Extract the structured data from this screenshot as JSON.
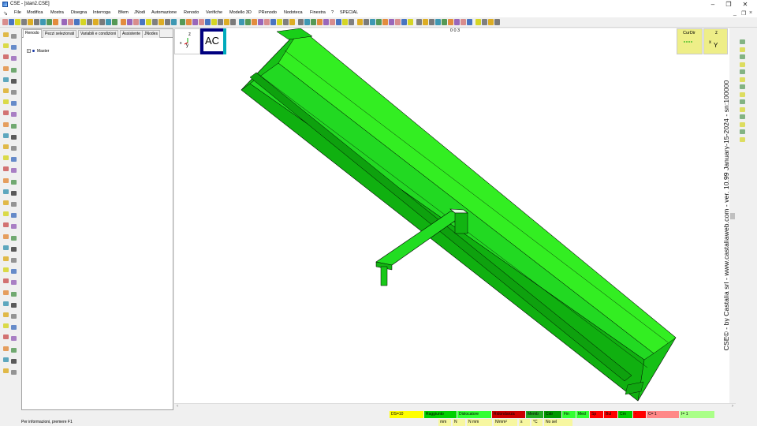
{
  "window": {
    "title": "CSE - [stan2.CSE]",
    "controls": {
      "minimize": "–",
      "restore": "❐",
      "close": "✕"
    },
    "mdi_controls": {
      "minimize": "_",
      "restore": "❐",
      "close": "×"
    }
  },
  "menu": {
    "items": [
      "File",
      "Modifica",
      "Mostra",
      "Disegna",
      "Interroga",
      "Bfem",
      "JNodi",
      "Automazione",
      "Renodo",
      "Verifiche",
      "Modello 3D",
      "PRenodo",
      "Nodoteca",
      "Finestra",
      "?",
      "SPECIAL"
    ]
  },
  "panel": {
    "tabs": [
      "Renodo",
      "Pezzi selezionati",
      "Variabili e condizioni",
      "Assistente",
      "JNodes"
    ],
    "active_tab": "Renodo",
    "tree": {
      "expander": "+",
      "root_label": "Master"
    }
  },
  "viewport": {
    "view_label": "0 0 3",
    "axis_indicator_left": {
      "z": "z",
      "x": "x",
      "y": "y"
    },
    "ac_badge": "AC",
    "curdir": {
      "label": "CurDir"
    },
    "axis_indicator_right": {
      "z": "z",
      "x": "x",
      "y": "Y"
    },
    "model_color": "#22d922",
    "version_text": "CSE© - by Castalia srl - www.castaliaweb.com - ver. 10.99 January-15-2024 - sn:100000"
  },
  "status": {
    "info_text": "Per informazioni, premere F1",
    "legend": [
      {
        "label": "DS=10",
        "color": "#ffff00"
      },
      {
        "label": "Raggiunto",
        "color": "#00d000"
      },
      {
        "label": "Dislocatore",
        "color": "#33ff33"
      },
      {
        "label": "Ridondanza",
        "color": "#cc0000"
      },
      {
        "label": "Memb",
        "color": "#22aa22"
      },
      {
        "label": "Cxtr",
        "color": "#009900"
      },
      {
        "label": "Fin",
        "color": "#33ff33"
      },
      {
        "label": "Med",
        "color": "#33ff33"
      },
      {
        "label": "Sp",
        "color": "#ff0000"
      },
      {
        "label": "Bul",
        "color": "#ff0000"
      },
      {
        "label": "Crn",
        "color": "#00cc00"
      },
      {
        "label": "-",
        "color": "#ff0000"
      },
      {
        "label": "C= 1",
        "color": "#ff8888"
      },
      {
        "label": "I= 1",
        "color": "#aaff88"
      }
    ],
    "units": [
      "mm",
      "N",
      "N mm",
      "N/mm²",
      "s",
      "°C",
      "No sel"
    ]
  },
  "colors": {
    "accent_blue": "#1a3aa8",
    "ac_badge_bg": "#000080",
    "ac_badge_teal": "#00aabb",
    "axis_box_bg": "#eeee88"
  }
}
